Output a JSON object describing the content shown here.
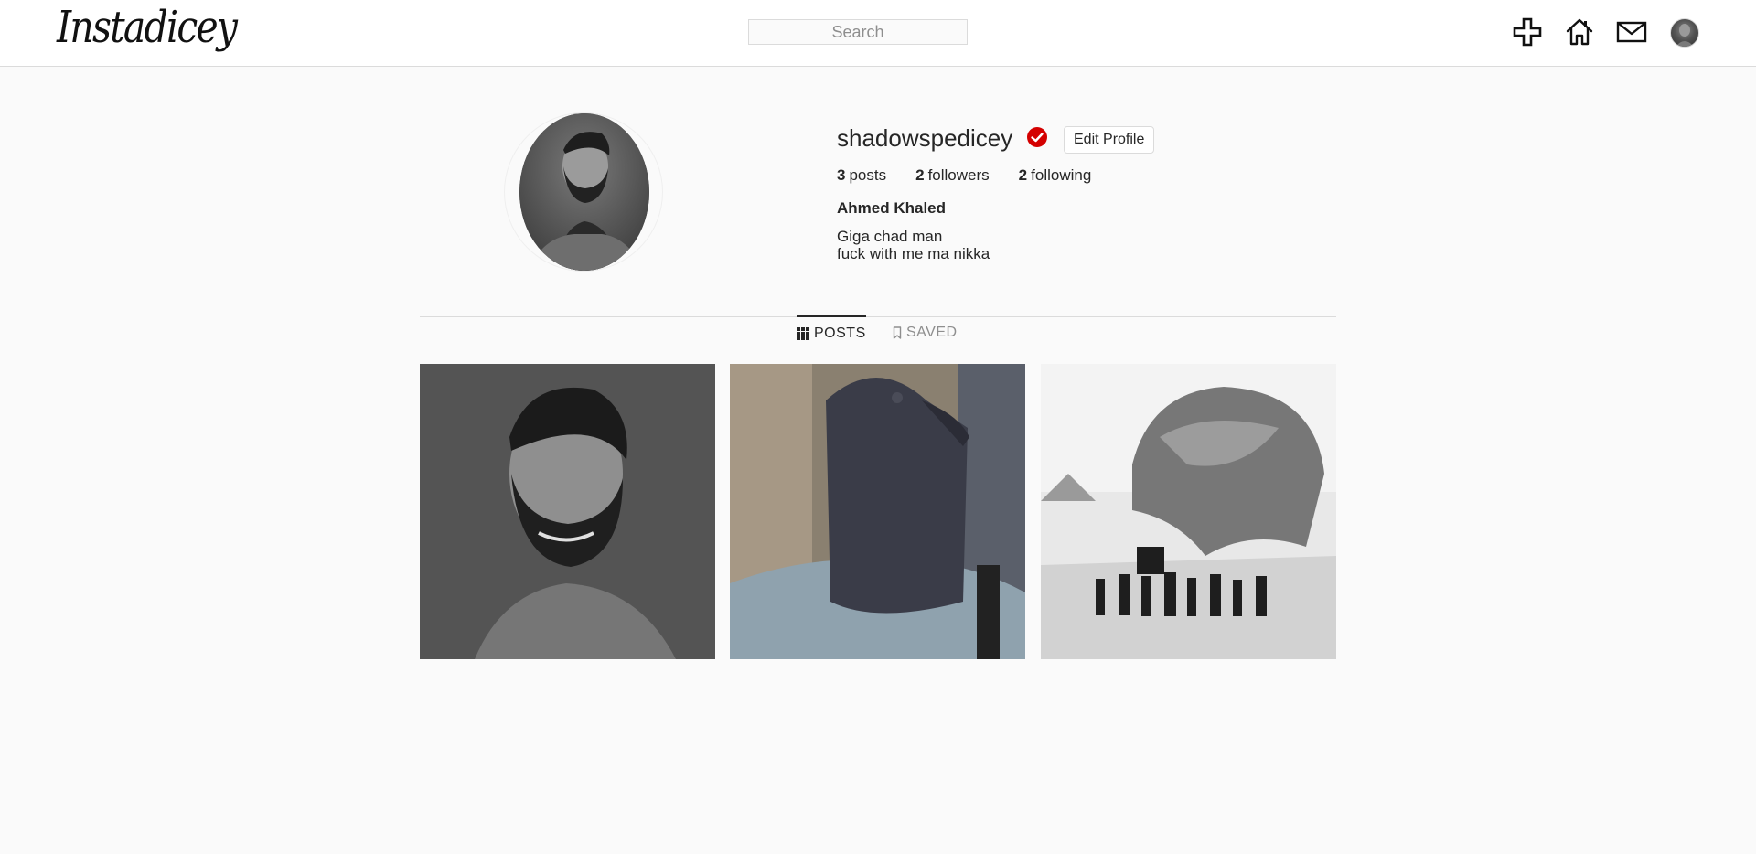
{
  "header": {
    "logo_text": "Instadicey",
    "search_placeholder": "Search",
    "icons": [
      "plus-icon",
      "home-icon",
      "mail-icon",
      "avatar"
    ]
  },
  "profile": {
    "username": "shadowspedicey",
    "verified": true,
    "edit_button_label": "Edit Profile",
    "stats": {
      "posts_count": "3",
      "posts_label": "posts",
      "followers_count": "2",
      "followers_label": "followers",
      "following_count": "2",
      "following_label": "following"
    },
    "full_name": "Ahmed Khaled",
    "bio_lines": [
      "Giga chad man",
      "fuck with me ma nikka"
    ]
  },
  "tabs": [
    {
      "label": "POSTS",
      "icon": "grid-icon",
      "active": true
    },
    {
      "label": "SAVED",
      "icon": "bookmark-icon",
      "active": false
    }
  ],
  "posts": [
    {
      "description": "grayscale portrait"
    },
    {
      "description": "person in cap"
    },
    {
      "description": "sphinx photograph"
    }
  ],
  "colors": {
    "verified": "#d40000",
    "background": "#fafafa",
    "text": "#262626",
    "muted": "#8e8e8e",
    "border": "#dbdbdb"
  }
}
